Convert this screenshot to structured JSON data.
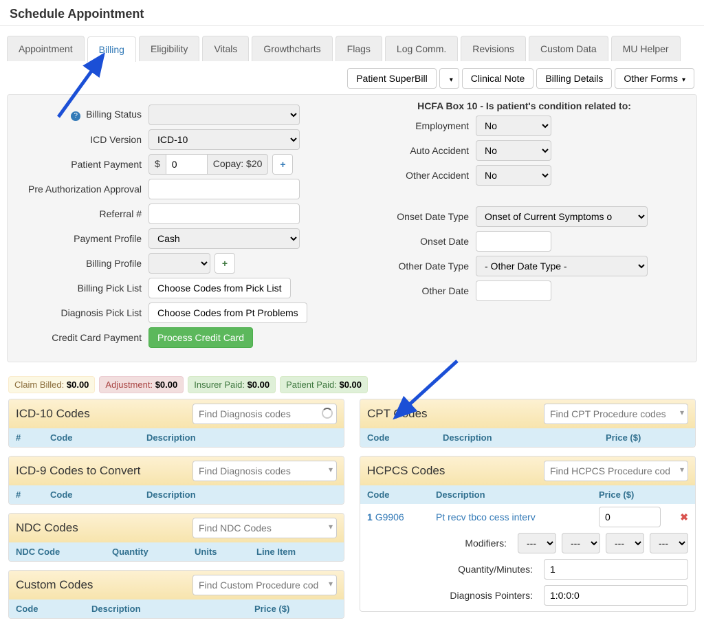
{
  "page": {
    "title": "Schedule Appointment"
  },
  "tabs": {
    "appointment": "Appointment",
    "billing": "Billing",
    "eligibility": "Eligibility",
    "vitals": "Vitals",
    "growthcharts": "Growthcharts",
    "flags": "Flags",
    "logcomm": "Log Comm.",
    "revisions": "Revisions",
    "customdata": "Custom Data",
    "muhelper": "MU Helper"
  },
  "toolbar": {
    "superbill": "Patient SuperBill",
    "clinicalnote": "Clinical Note",
    "billingdetails": "Billing Details",
    "otherforms": "Other Forms"
  },
  "formLeft": {
    "billingStatus": "Billing Status",
    "icdVersion": "ICD Version",
    "icdVersionValue": "ICD-10",
    "patientPayment": "Patient Payment",
    "patientPaymentCurrency": "$",
    "patientPaymentValue": "0",
    "copay": "Copay: $20",
    "preAuth": "Pre Authorization Approval",
    "referral": "Referral #",
    "paymentProfile": "Payment Profile",
    "paymentProfileValue": "Cash",
    "billingProfile": "Billing Profile",
    "billingPickList": "Billing Pick List",
    "billingPickListBtn": "Choose Codes from Pick List",
    "diagnosisPickList": "Diagnosis Pick List",
    "diagnosisPickListBtn": "Choose Codes from Pt Problems",
    "ccPayment": "Credit Card Payment",
    "ccPaymentBtn": "Process Credit Card"
  },
  "hcfa": {
    "title": "HCFA Box 10 - Is patient's condition related to:",
    "employment": "Employment",
    "autoAccident": "Auto Accident",
    "otherAccident": "Other Accident",
    "no": "No",
    "onsetDateType": "Onset Date Type",
    "onsetDateTypeValue": "Onset of Current Symptoms o",
    "onsetDate": "Onset Date",
    "otherDateType": "Other Date Type",
    "otherDateTypeValue": "- Other Date Type -",
    "otherDate": "Other Date"
  },
  "summary": {
    "claimBilled": "Claim Billed:",
    "claimBilledVal": "$0.00",
    "adjustment": "Adjustment:",
    "adjustmentVal": "$0.00",
    "insurerPaid": "Insurer Paid:",
    "insurerPaidVal": "$0.00",
    "patientPaid": "Patient Paid:",
    "patientPaidVal": "$0.00"
  },
  "panels": {
    "icd10": {
      "title": "ICD-10 Codes",
      "placeholder": "Find Diagnosis codes",
      "headers": {
        "num": "#",
        "code": "Code",
        "desc": "Description"
      }
    },
    "icd9": {
      "title": "ICD-9 Codes to Convert",
      "placeholder": "Find Diagnosis codes",
      "headers": {
        "num": "#",
        "code": "Code",
        "desc": "Description"
      }
    },
    "ndc": {
      "title": "NDC Codes",
      "placeholder": "Find NDC Codes",
      "headers": {
        "code": "NDC Code",
        "qty": "Quantity",
        "units": "Units",
        "line": "Line Item"
      }
    },
    "custom": {
      "title": "Custom Codes",
      "placeholder": "Find Custom Procedure codes",
      "headers": {
        "code": "Code",
        "desc": "Description",
        "price": "Price ($)"
      }
    },
    "cpt": {
      "title": "CPT Codes",
      "placeholder": "Find CPT Procedure codes",
      "headers": {
        "code": "Code",
        "desc": "Description",
        "price": "Price ($)"
      }
    },
    "hcpcs": {
      "title": "HCPCS Codes",
      "placeholder": "Find HCPCS Procedure codes",
      "headers": {
        "code": "Code",
        "desc": "Description",
        "price": "Price ($)"
      },
      "row": {
        "idx": "1",
        "code": "G9906",
        "desc": "Pt recv tbco cess interv",
        "price": "0"
      },
      "modifiers": "Modifiers:",
      "modOption": "---",
      "qty": "Quantity/Minutes:",
      "qtyVal": "1",
      "dp": "Diagnosis Pointers:",
      "dpVal": "1:0:0:0"
    }
  }
}
